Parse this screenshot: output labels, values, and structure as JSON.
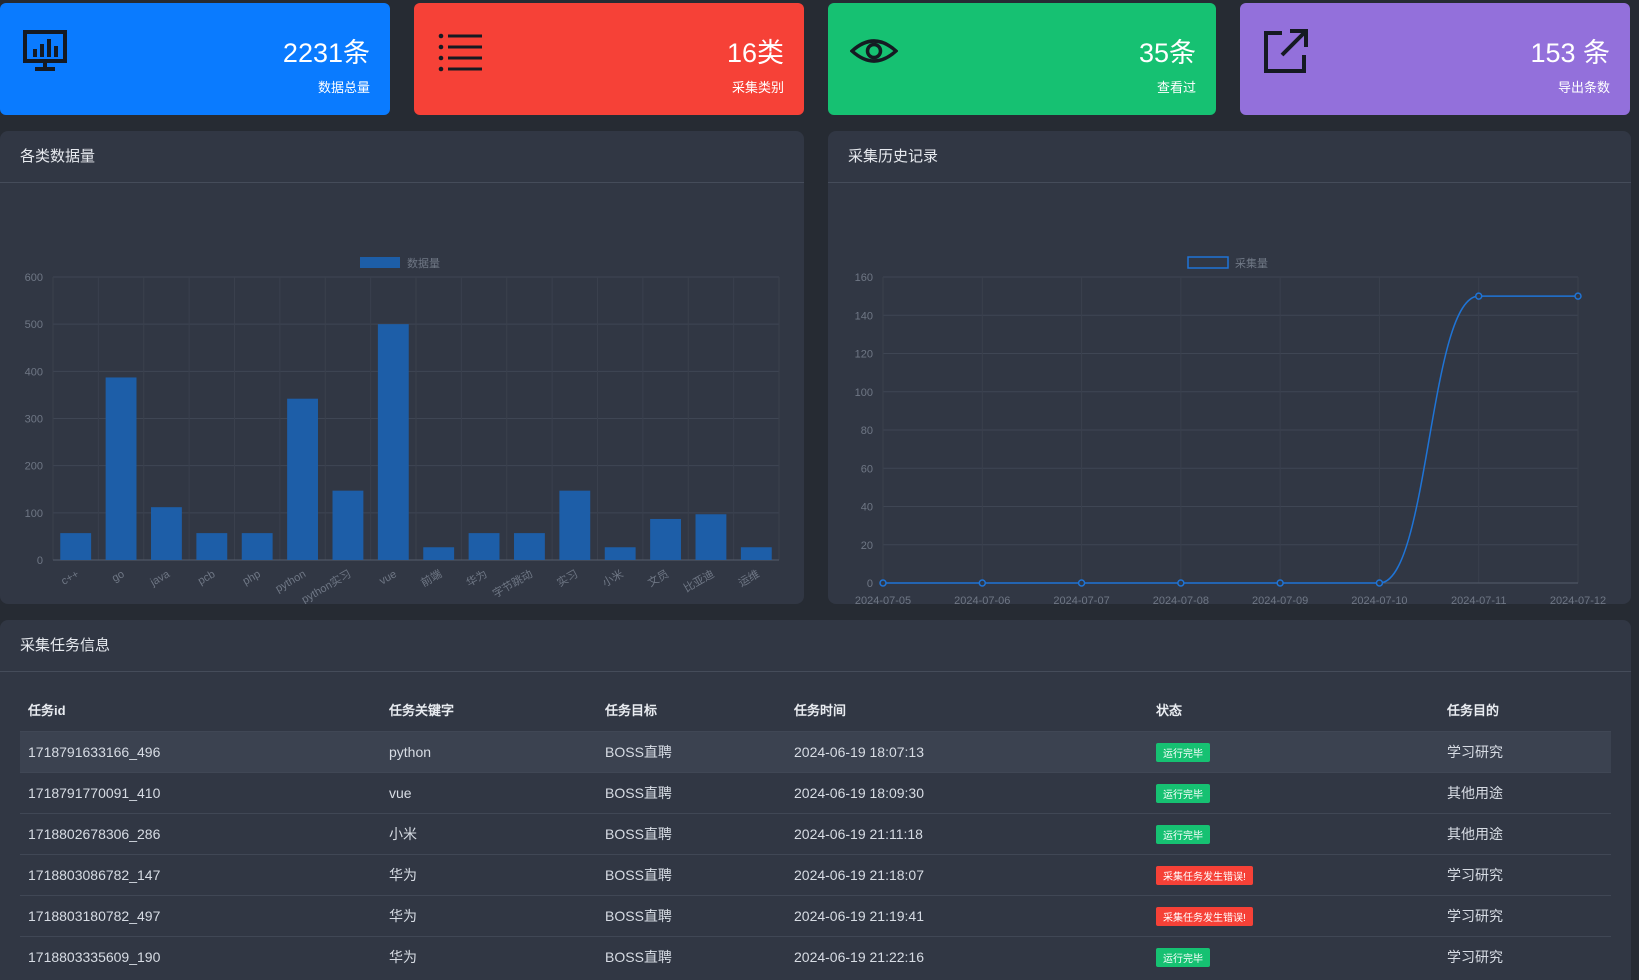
{
  "stats": [
    {
      "value": "2231条",
      "label": "数据总量",
      "color": "#0a7bff",
      "icon": "monitor-chart-icon"
    },
    {
      "value": "16类",
      "label": "采集类别",
      "color": "#f64137",
      "icon": "list-icon"
    },
    {
      "value": "35条",
      "label": "查看过",
      "color": "#16c172",
      "icon": "eye-icon"
    },
    {
      "value": "153 条",
      "label": "导出条数",
      "color": "#9370db",
      "icon": "external-link-icon"
    }
  ],
  "bar_panel": {
    "title": "各类数据量"
  },
  "line_panel": {
    "title": "采集历史记录"
  },
  "table_panel": {
    "title": "采集任务信息",
    "columns": [
      "任务id",
      "任务关键字",
      "任务目标",
      "任务时间",
      "状态",
      "任务目的"
    ],
    "rows": [
      {
        "id": "1718791633166_496",
        "keyword": "python",
        "target": "BOSS直聘",
        "time": "2024-06-19 18:07:13",
        "status": "运行完毕",
        "status_color": "#16c172",
        "purpose": "学习研究"
      },
      {
        "id": "1718791770091_410",
        "keyword": "vue",
        "target": "BOSS直聘",
        "time": "2024-06-19 18:09:30",
        "status": "运行完毕",
        "status_color": "#16c172",
        "purpose": "其他用途"
      },
      {
        "id": "1718802678306_286",
        "keyword": "小米",
        "target": "BOSS直聘",
        "time": "2024-06-19 21:11:18",
        "status": "运行完毕",
        "status_color": "#16c172",
        "purpose": "其他用途"
      },
      {
        "id": "1718803086782_147",
        "keyword": "华为",
        "target": "BOSS直聘",
        "time": "2024-06-19 21:18:07",
        "status": "采集任务发生错误!",
        "status_color": "#f64137",
        "purpose": "学习研究"
      },
      {
        "id": "1718803180782_497",
        "keyword": "华为",
        "target": "BOSS直聘",
        "time": "2024-06-19 21:19:41",
        "status": "采集任务发生错误!",
        "status_color": "#f64137",
        "purpose": "学习研究"
      },
      {
        "id": "1718803335609_190",
        "keyword": "华为",
        "target": "BOSS直聘",
        "time": "2024-06-19 21:22:16",
        "status": "运行完毕",
        "status_color": "#16c172",
        "purpose": "学习研究"
      }
    ]
  },
  "chart_data": [
    {
      "type": "bar",
      "legend": "数据量",
      "series_color": "#1d5ea8",
      "categories": [
        "c++",
        "go",
        "java",
        "pcb",
        "php",
        "python",
        "python实习",
        "vue",
        "前端",
        "华为",
        "字节跳动",
        "实习",
        "小米",
        "文员",
        "比亚迪",
        "运维"
      ],
      "values": [
        57,
        387,
        112,
        57,
        57,
        342,
        147,
        500,
        27,
        57,
        57,
        147,
        27,
        87,
        97,
        27
      ],
      "yticks": [
        0,
        100,
        200,
        300,
        400,
        500,
        600
      ],
      "ylim": [
        0,
        600
      ],
      "grid": true,
      "legend_position": "top-center"
    },
    {
      "type": "line",
      "legend": "采集量",
      "series_color": "#1f74d6",
      "x": [
        "2024-07-05",
        "2024-07-06",
        "2024-07-07",
        "2024-07-08",
        "2024-07-09",
        "2024-07-10",
        "2024-07-11",
        "2024-07-12"
      ],
      "values": [
        0,
        0,
        0,
        0,
        0,
        0,
        150,
        150
      ],
      "yticks": [
        0,
        20,
        40,
        60,
        80,
        100,
        120,
        140,
        160
      ],
      "ylim": [
        0,
        160
      ],
      "smooth": true,
      "grid": true,
      "legend_position": "top-center"
    }
  ]
}
